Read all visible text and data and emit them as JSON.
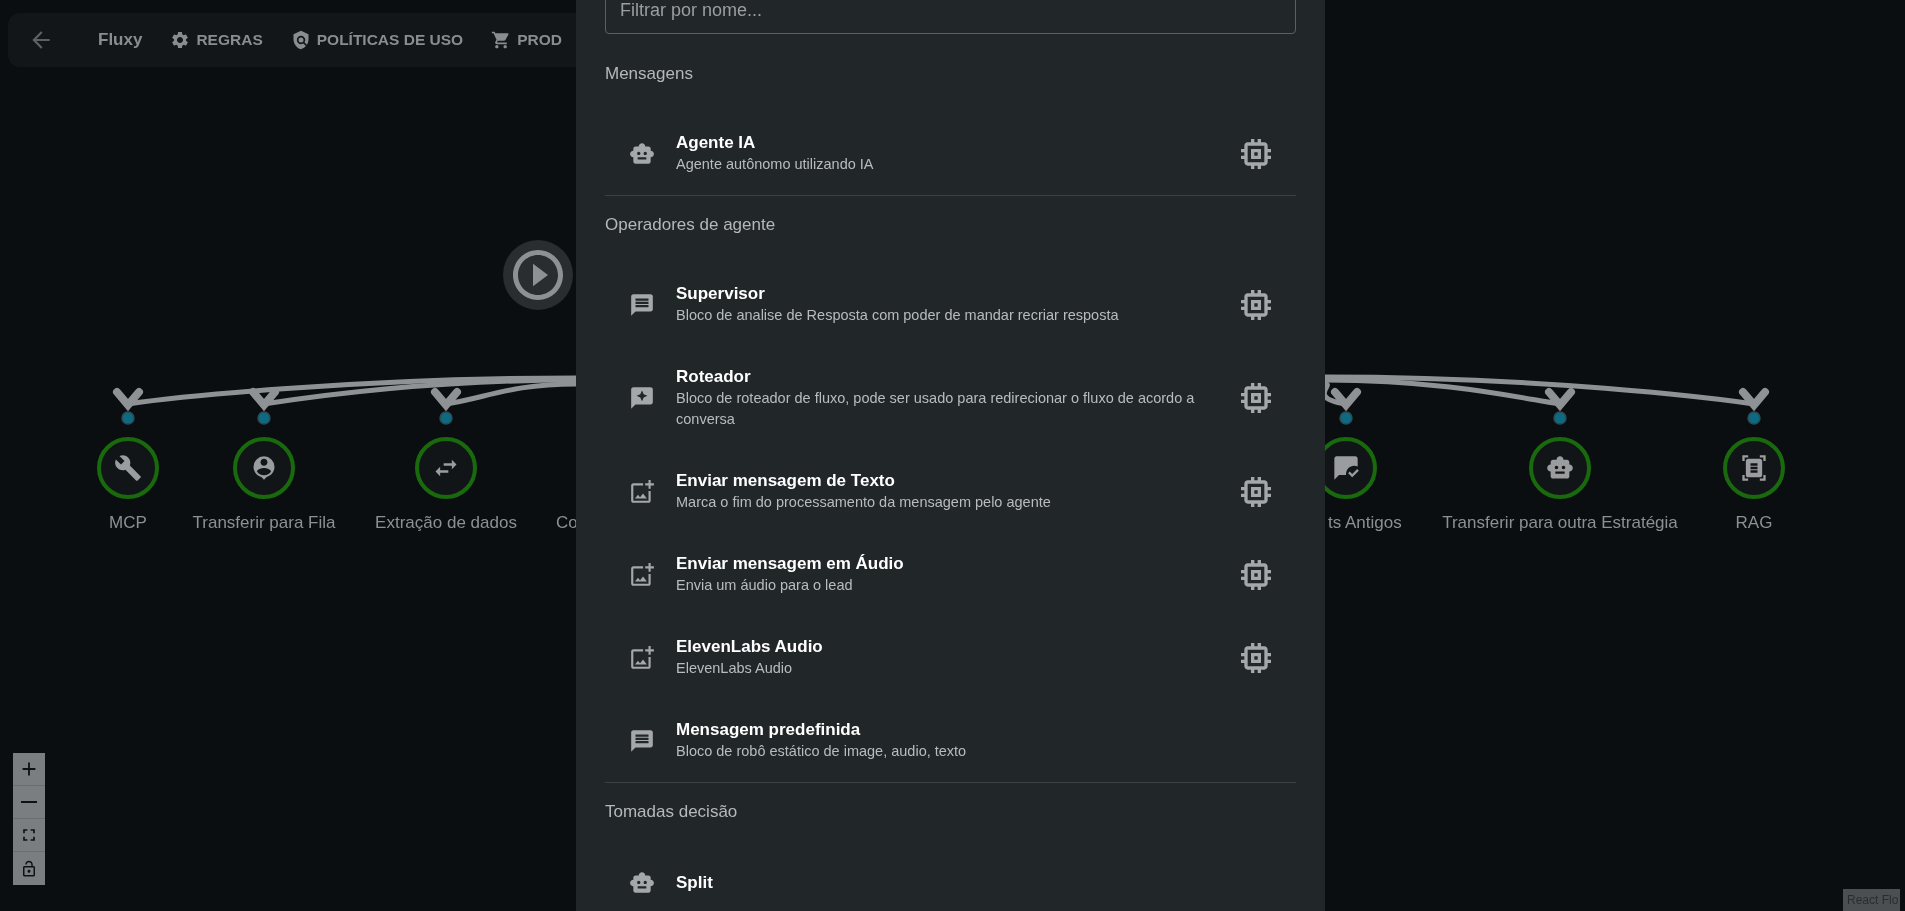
{
  "toolbar": {
    "items": [
      {
        "kind": "back"
      },
      {
        "kind": "title",
        "label": "Fluxy"
      },
      {
        "kind": "rules",
        "label": "REGRAS"
      },
      {
        "kind": "policy",
        "label": "POLÍTICAS DE USO"
      },
      {
        "kind": "cart",
        "label": "PROD"
      }
    ]
  },
  "canvas": {
    "nodes": [
      {
        "kind": "tool",
        "label": "MCP"
      },
      {
        "kind": "queue",
        "label": "Transferir para Fila"
      },
      {
        "kind": "swap",
        "label": "Extração de dados"
      },
      {
        "kind": "chat_check",
        "label": "ts Antigos"
      },
      {
        "kind": "robot",
        "label": "Transferir para outra Estratégia"
      },
      {
        "kind": "scan",
        "label": "RAG"
      }
    ],
    "clipped_label": "Co",
    "attribution": "React Flo"
  },
  "panel": {
    "filter": {
      "placeholder": "Filtrar por nome..."
    },
    "sections": [
      {
        "title": "Mensagens",
        "items": [
          {
            "kind": "robot",
            "title": "Agente IA",
            "description": "Agente autônomo utilizando IA",
            "ai": true
          }
        ]
      },
      {
        "title": "Operadores de agente",
        "items": [
          {
            "kind": "message",
            "title": "Supervisor",
            "description": "Bloco de analise de Resposta com poder de mandar recriar resposta",
            "ai": true
          },
          {
            "kind": "sparkle_chat",
            "title": "Roteador",
            "description": "Bloco de roteador de fluxo, pode ser usado para redirecionar o fluxo de acordo a conversa",
            "ai": true
          },
          {
            "kind": "media",
            "title": "Enviar mensagem de Texto",
            "description": "Marca o fim do processamento da mensagem pelo agente",
            "ai": true
          },
          {
            "kind": "media",
            "title": "Enviar mensagem em Áudio",
            "description": "Envia um áudio para o lead",
            "ai": true
          },
          {
            "kind": "media",
            "title": "ElevenLabs Audio",
            "description": "ElevenLabs Audio",
            "ai": true
          },
          {
            "kind": "message",
            "title": "Mensagem predefinida",
            "description": "Bloco de robô estático de image, audio, texto",
            "ai": false
          }
        ]
      },
      {
        "title": "Tomadas decisão",
        "items": [
          {
            "kind": "robot",
            "title": "Split",
            "ai": false
          }
        ]
      }
    ]
  }
}
